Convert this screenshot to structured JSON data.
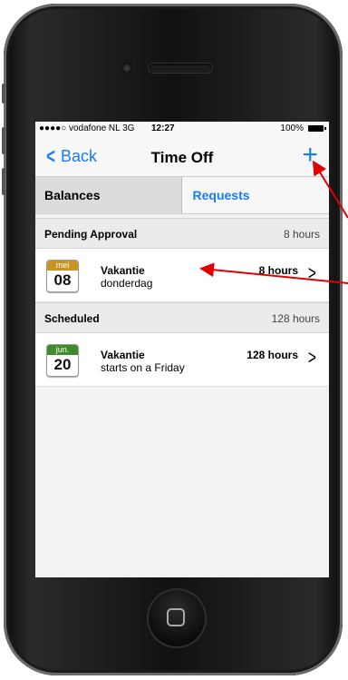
{
  "status_bar": {
    "carrier": "●●●●○ vodafone NL  3G",
    "time": "12:27",
    "battery": "100%"
  },
  "nav": {
    "back_label": "Back",
    "title": "Time Off",
    "add_label": "+"
  },
  "tabs": [
    {
      "label": "Balances",
      "selected": true
    },
    {
      "label": "Requests",
      "selected": false
    }
  ],
  "sections": [
    {
      "label": "Pending Approval",
      "total": "8 hours",
      "items": [
        {
          "month": "mei",
          "day": "08",
          "month_color": "#c89422",
          "title": "Vakantie",
          "subtitle": "donderdag",
          "hours": "8 hours"
        }
      ]
    },
    {
      "label": "Scheduled",
      "total": "128 hours",
      "items": [
        {
          "month": "jun.",
          "day": "20",
          "month_color": "#3f8a2b",
          "title": "Vakantie",
          "subtitle": "starts on a Friday",
          "hours": "128 hours"
        }
      ]
    }
  ],
  "colors": {
    "accent": "#1a7cf5",
    "annotation_arrow": "#e00000"
  }
}
